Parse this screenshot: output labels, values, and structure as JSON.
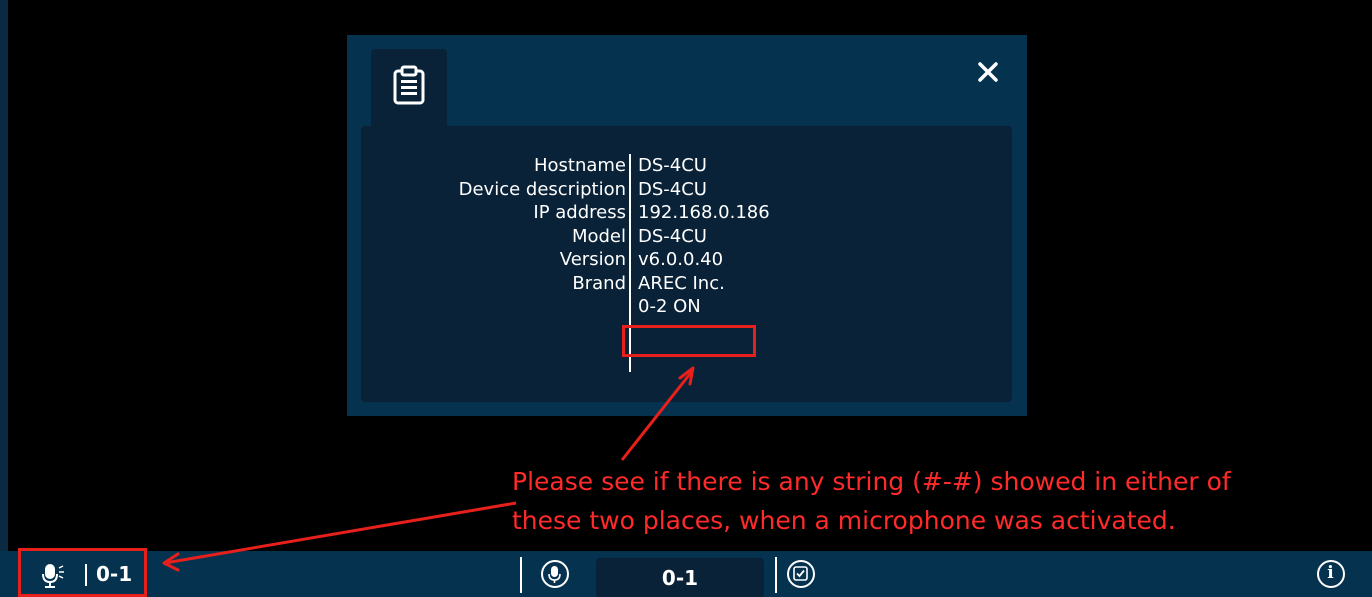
{
  "dialog": {
    "rows": [
      {
        "label": "Hostname",
        "value": "DS-4CU"
      },
      {
        "label": "Device description",
        "value": "DS-4CU"
      },
      {
        "label": "IP address",
        "value": "192.168.0.186"
      },
      {
        "label": "Model",
        "value": "DS-4CU"
      },
      {
        "label": "Version",
        "value": "v6.0.0.40"
      },
      {
        "label": "Brand",
        "value": "AREC Inc."
      },
      {
        "label": "",
        "value": "0-2 ON"
      }
    ],
    "tab_icon": "clipboard-icon",
    "close_icon": "close-icon"
  },
  "annotation": {
    "line1": "Please see if there is any string (#-#) showed in either of",
    "line2": "these two places, when a microphone was activated.",
    "color": "#e8201c"
  },
  "statusbar": {
    "left_mic_text": "0-1",
    "center_display": "0-1",
    "icons": [
      "microphone-speaking-icon",
      "microphone-circle-icon",
      "checkbox-circle-icon",
      "info-icon"
    ],
    "info_glyph": "i"
  },
  "colors": {
    "panel": "#05334f",
    "panel_inner": "#0a2238",
    "background": "#000000"
  }
}
